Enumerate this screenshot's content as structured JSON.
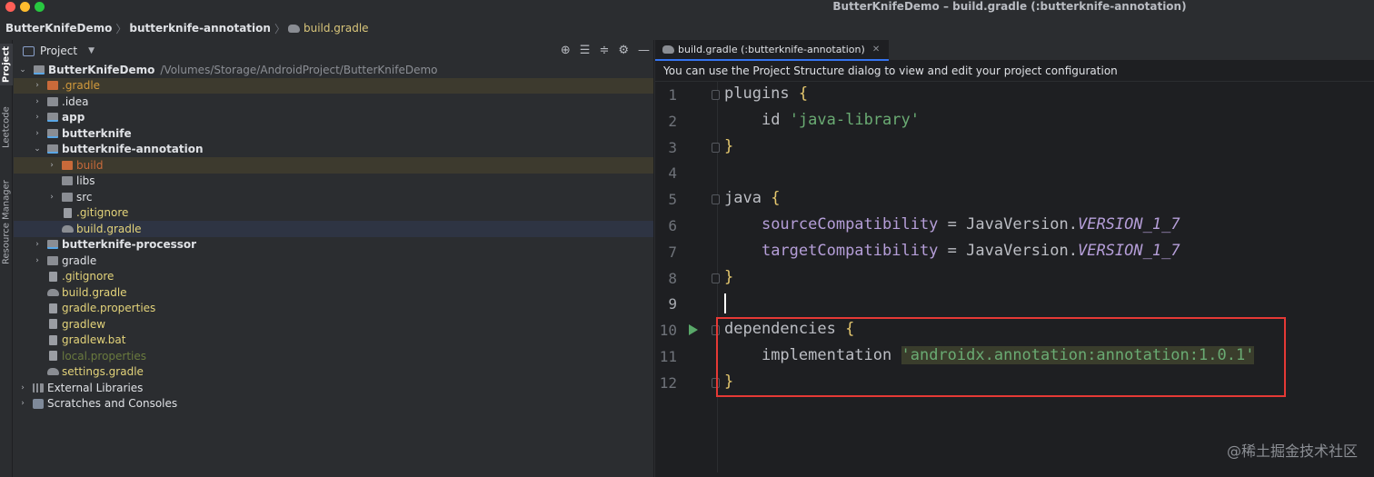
{
  "window": {
    "title": "ButterKnifeDemo – build.gradle (:butterknife-annotation)"
  },
  "breadcrumb": {
    "items": [
      "ButterKnifeDemo",
      "butterknife-annotation"
    ],
    "file": "build.gradle"
  },
  "toolstrip": {
    "tabs": [
      "Project",
      "Leetcode",
      "Resource Manager"
    ]
  },
  "project_panel": {
    "title": "Project",
    "root_name": "ButterKnifeDemo",
    "root_path": "/Volumes/Storage/AndroidProject/ButterKnifeDemo",
    "items": [
      ".gradle",
      ".idea",
      "app",
      "butterknife",
      "butterknife-annotation",
      "build",
      "libs",
      "src",
      ".gitignore",
      "build.gradle",
      "butterknife-processor",
      "gradle",
      ".gitignore",
      "build.gradle",
      "gradle.properties",
      "gradlew",
      "gradlew.bat",
      "local.properties",
      "settings.gradle",
      "External Libraries",
      "Scratches and Consoles"
    ]
  },
  "editor": {
    "tab_label": "build.gradle (:butterknife-annotation)",
    "notice": "You can use the Project Structure dialog to view and edit your project configuration",
    "line_numbers": [
      "1",
      "2",
      "3",
      "4",
      "5",
      "6",
      "7",
      "8",
      "9",
      "10",
      "11",
      "12"
    ],
    "code": {
      "plugins": "plugins",
      "id_kw": "id",
      "id_val": "'java-library'",
      "java": "java",
      "src_compat": "sourceCompatibility",
      "tgt_compat": "targetCompatibility",
      "javaversion": "JavaVersion.",
      "version": "VERSION_1_7",
      "dependencies": "dependencies",
      "implementation": "implementation",
      "dep_val": "'androidx.annotation:annotation:1.0.1'",
      "lbrace": "{",
      "rbrace": "}",
      "eq": " = "
    }
  },
  "watermark": "@稀土掘金技术社区",
  "colors": {
    "accent": "#3574f0",
    "highlight_box": "#e53935",
    "run_icon": "#59a869"
  }
}
